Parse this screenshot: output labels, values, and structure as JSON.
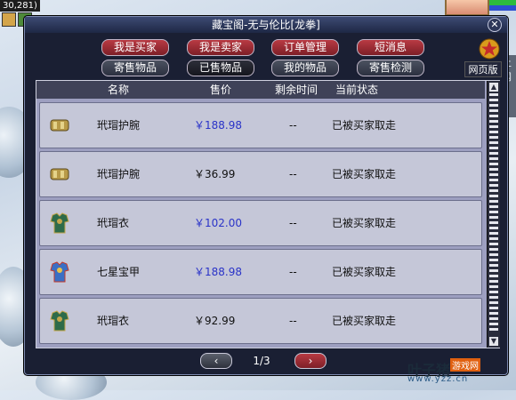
{
  "hud": {
    "coordinates": "30,281)"
  },
  "window": {
    "title": "藏宝阁-无与伦比[龙拳]",
    "close_label": "✕"
  },
  "tabs_row1": [
    {
      "label": "我是买家",
      "color": "red"
    },
    {
      "label": "我是卖家",
      "color": "red"
    },
    {
      "label": "订单管理",
      "color": "red"
    },
    {
      "label": "短消息",
      "color": "red"
    }
  ],
  "tabs_row2": [
    {
      "label": "寄售物品"
    },
    {
      "label": "已售物品"
    },
    {
      "label": "我的物品"
    },
    {
      "label": "寄售检测"
    }
  ],
  "web_version_label": "网页版",
  "table": {
    "columns": [
      "名称",
      "售价",
      "剩余时间",
      "当前状态"
    ],
    "rows": [
      {
        "icon": "bracer-icon",
        "name": "玳瑁护腕",
        "price": "￥188.98",
        "price_color": "#2a33c8",
        "time": "--",
        "status": "已被买家取走"
      },
      {
        "icon": "bracer-icon",
        "name": "玳瑁护腕",
        "price": "￥36.99",
        "price_color": "#111111",
        "time": "--",
        "status": "已被买家取走"
      },
      {
        "icon": "armor-icon",
        "name": "玳瑁衣",
        "price": "￥102.00",
        "price_color": "#2a33c8",
        "time": "--",
        "status": "已被买家取走"
      },
      {
        "icon": "armor-blue-icon",
        "name": "七星宝甲",
        "price": "￥188.98",
        "price_color": "#2a33c8",
        "time": "--",
        "status": "已被买家取走"
      },
      {
        "icon": "armor-icon",
        "name": "玳瑁衣",
        "price": "￥92.99",
        "price_color": "#111111",
        "time": "--",
        "status": "已被买家取走"
      }
    ]
  },
  "pager": {
    "page": "1/3",
    "prev": "‹",
    "next": "›"
  },
  "watermark": {
    "brand": "叶子猪",
    "tag": "游戏网",
    "url": "www.yzz.cn"
  },
  "side_panel": {
    "text": "上 网"
  }
}
